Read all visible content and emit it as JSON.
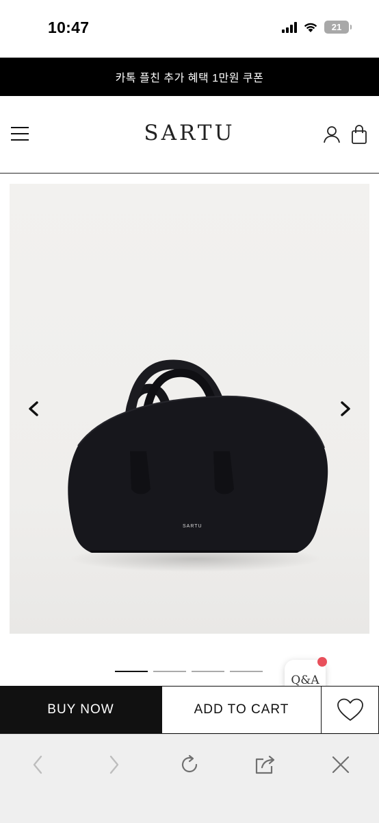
{
  "status_bar": {
    "time": "10:47",
    "battery": "21",
    "icons": [
      "cellular-signal-icon",
      "wifi-icon",
      "battery-icon"
    ]
  },
  "promo": {
    "text": "카톡 플친 추가 혜택 1만원 쿠폰"
  },
  "header": {
    "logo": "SARTU",
    "icons": [
      "menu-icon",
      "account-icon",
      "shopping-bag-icon"
    ]
  },
  "product": {
    "image_icon": "black-leather-handbag",
    "bag_logo": "SARTU",
    "carousel": {
      "prev_icon": "chevron-left-icon",
      "next_icon": "chevron-right-icon",
      "total_slides": 4,
      "active_slide": 1
    }
  },
  "qna": {
    "label": "Q&A",
    "has_notification": true,
    "badge_color": "#e8505b"
  },
  "actions": {
    "buy_now": "BUY NOW",
    "add_to_cart": "ADD TO CART",
    "wishlist_icon": "heart-icon"
  },
  "browser_toolbar": {
    "icons": [
      "back-icon",
      "forward-icon",
      "reload-icon",
      "share-icon",
      "close-icon"
    ]
  },
  "colors": {
    "primary": "#111111",
    "promo_bg": "#000000",
    "toolbar_bg": "#efefef",
    "image_bg": "#f2f1ef"
  }
}
